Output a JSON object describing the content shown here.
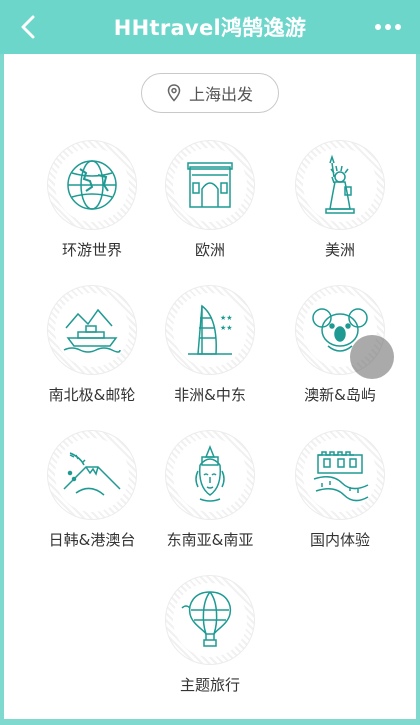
{
  "header": {
    "title": "HHtravel鸿鹄逸游"
  },
  "location": {
    "label": "上海出发"
  },
  "categories": [
    {
      "label": "环游世界",
      "icon": "globe-icon"
    },
    {
      "label": "欧洲",
      "icon": "arc-de-triomphe-icon"
    },
    {
      "label": "美洲",
      "icon": "statue-of-liberty-icon"
    },
    {
      "label": "南北极&邮轮",
      "icon": "cruise-ship-icon"
    },
    {
      "label": "非洲&中东",
      "icon": "burj-al-arab-icon"
    },
    {
      "label": "澳新&岛屿",
      "icon": "koala-icon"
    },
    {
      "label": "日韩&港澳台",
      "icon": "mount-fuji-icon"
    },
    {
      "label": "东南亚&南亚",
      "icon": "buddha-head-icon"
    },
    {
      "label": "国内体验",
      "icon": "great-wall-icon"
    },
    {
      "label": "主题旅行",
      "icon": "hot-air-balloon-icon"
    }
  ],
  "colors": {
    "accent": "#6cd6cb",
    "icon_stroke": "#1e9a93"
  }
}
